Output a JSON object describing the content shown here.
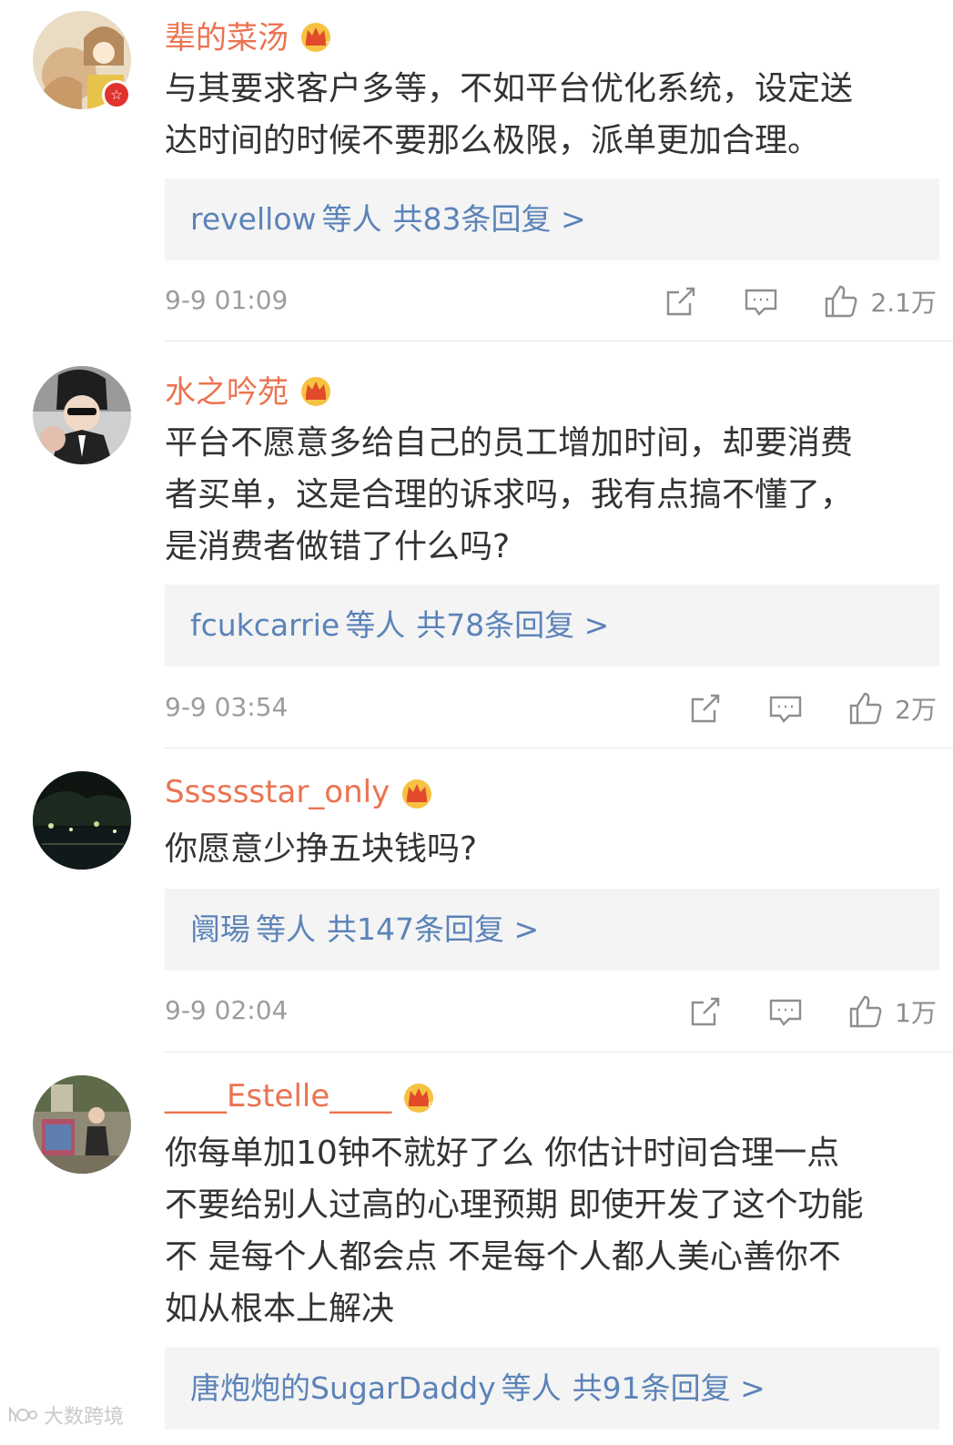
{
  "comments": [
    {
      "username": "辈的菜汤",
      "crown_level": "3",
      "verified": true,
      "content_lines": [
        "与其要求客户多等，不如平台优化系统，设定送",
        "达时间的时候不要那么极限，派单更加合理。"
      ],
      "reply_user": "revellow",
      "reply_mid": "等人",
      "reply_count": "共83条回复 >",
      "time": "9-9 01:09",
      "likes": "2.1万"
    },
    {
      "username": "水之吟苑",
      "crown_level": "",
      "verified": false,
      "content_lines": [
        "平台不愿意多给自己的员工增加时间，却要消费",
        "者买单，这是合理的诉求吗，我有点搞不懂了，",
        "是消费者做错了什么吗?"
      ],
      "reply_user": "fcukcarrie",
      "reply_mid": "等人",
      "reply_count": "共78条回复 >",
      "time": "9-9 03:54",
      "likes": "2万"
    },
    {
      "username": "Sssssstar_only",
      "crown_level": "",
      "verified": false,
      "content_lines": [
        "你愿意少挣五块钱吗?"
      ],
      "reply_user": "阛瑒",
      "reply_mid": "等人",
      "reply_count": "共147条回复 >",
      "time": "9-9 02:04",
      "likes": "1万"
    },
    {
      "username": "____Estelle____",
      "crown_level": "5",
      "verified": false,
      "content_lines": [
        "你每单加10钟不就好了么 你估计时间合理一点",
        "不要给别人过高的心理预期 即使开发了这个功能",
        "不 是每个人都会点  不是每个人都人美心善你不",
        "如从根本上解决"
      ],
      "reply_user": "唐炮炮的SugarDaddy",
      "reply_mid": "等人",
      "reply_count": "共91条回复 >",
      "time": "",
      "likes": ""
    }
  ],
  "watermark": "大数跨境",
  "colors": {
    "username": "#eb7350",
    "reply_link": "#5b83b8",
    "body_text": "#333333",
    "meta": "#9c9c9c",
    "reply_bg": "#f4f4f4"
  },
  "icons": [
    "share-icon",
    "comment-icon",
    "like-icon",
    "crown-icon",
    "verified-badge-icon"
  ]
}
